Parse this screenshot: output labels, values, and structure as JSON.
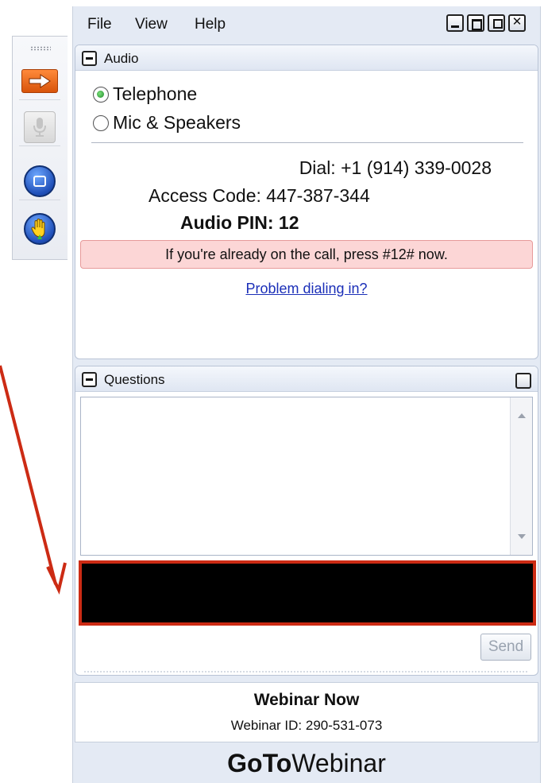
{
  "menu": {
    "file": "File",
    "view": "View",
    "help": "Help"
  },
  "window_controls": {
    "popout_glyph": "⧉",
    "close_glyph": "✕"
  },
  "toolbar": {
    "icons": [
      "arrow-right-icon",
      "microphone-icon",
      "screen-icon",
      "raise-hand-icon"
    ],
    "accent": "#e8651a"
  },
  "audio": {
    "title": "Audio",
    "options": [
      {
        "label": "Telephone",
        "selected": true
      },
      {
        "label": "Mic & Speakers",
        "selected": false
      }
    ],
    "dial": "Dial: +1 (914) 339-0028",
    "access_code": "Access Code: 447-387-344",
    "audio_pin": "Audio PIN: 12",
    "notice": "If you're already on the call, press #12# now.",
    "notice_color": "#fcd6d6",
    "problem_link": "Problem dialing in?"
  },
  "questions": {
    "title": "Questions",
    "send_label": "Send",
    "highlight_color": "#cc2b14"
  },
  "webinar": {
    "title": "Webinar Now",
    "id_text": "Webinar ID: 290-531-073"
  },
  "brand": {
    "bold": "GoTo",
    "regular": "Webinar"
  }
}
